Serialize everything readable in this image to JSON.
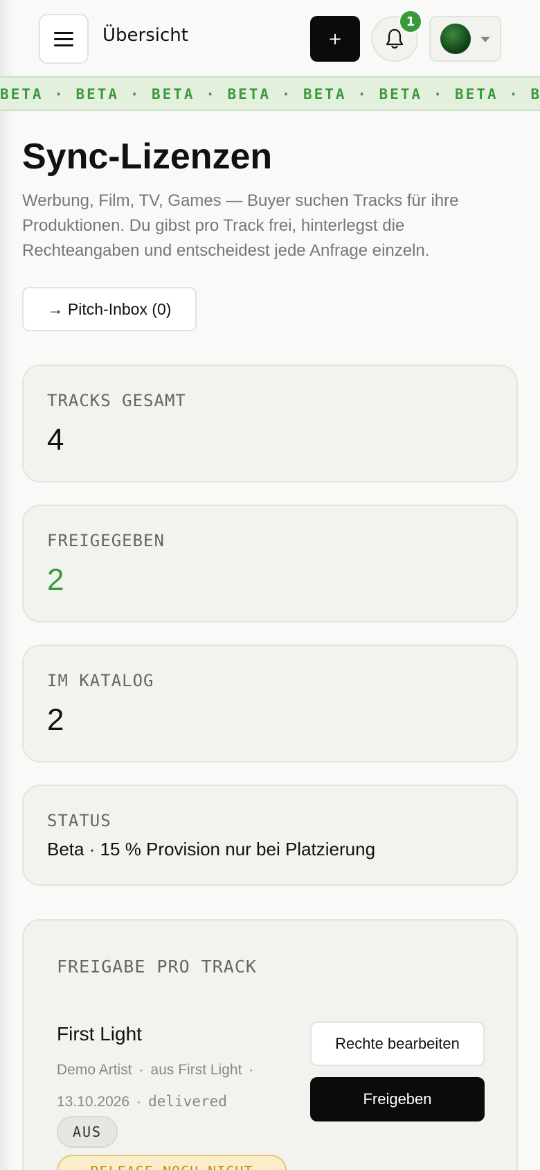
{
  "header": {
    "title": "Übersicht",
    "add_label": "+",
    "notification_count": "1"
  },
  "beta_strip": {
    "text": "BETA · BETA · BETA · BETA · BETA · BETA · BETA · BETA · BETA"
  },
  "main": {
    "heading": "Sync-Lizenzen",
    "intro": "Werbung, Film, TV, Games — Buyer suchen Tracks für ihre Produktionen. Du gibst pro Track frei, hinterlegst die Rechteangaben und entscheidest jede Anfrage einzeln.",
    "pitch_inbox_label": "→ Pitch-Inbox (0)"
  },
  "stats": [
    {
      "label": "TRACKS GESAMT",
      "value": "4"
    },
    {
      "label": "FREIGEGEBEN",
      "value": "2"
    },
    {
      "label": "IM KATALOG",
      "value": "2"
    },
    {
      "label": "STATUS",
      "value": "Beta · 15 % Provision nur bei Platzierung"
    }
  ],
  "release": {
    "section_label": "FREIGABE PRO TRACK",
    "track": {
      "title": "First Light",
      "artist": "Demo Artist",
      "album": "aus First Light",
      "date": "13.10.2026",
      "status": "delivered",
      "toggle_badge": "AUS",
      "warning_badge": "RELEASE NOCH NICHT"
    },
    "edit_rights_label": "Rechte bearbeiten",
    "release_label": "Freigeben"
  },
  "colors": {
    "accent_green": "#3a9a3a",
    "primary_button": "#0b0b0b",
    "warning": "#c98a12"
  },
  "icons": {
    "menu": "hamburger-icon",
    "notifications": "bell-icon",
    "user_menu": "chevron-down-icon"
  }
}
